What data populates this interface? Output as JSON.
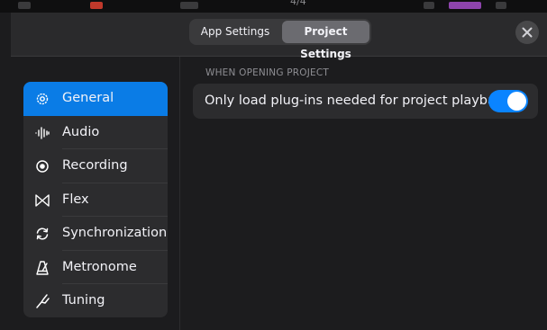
{
  "top_strip": {
    "time_signature": "4/4"
  },
  "tabs": [
    {
      "label": "App Settings",
      "selected": false
    },
    {
      "label": "Project Settings",
      "selected": true
    }
  ],
  "close_icon": "xmark-icon",
  "sidebar": {
    "items": [
      {
        "label": "General",
        "icon": "gear-icon",
        "active": true
      },
      {
        "label": "Audio",
        "icon": "waveform-icon",
        "active": false
      },
      {
        "label": "Recording",
        "icon": "record-icon",
        "active": false
      },
      {
        "label": "Flex",
        "icon": "flex-icon",
        "active": false
      },
      {
        "label": "Synchronization",
        "icon": "sync-icon",
        "active": false
      },
      {
        "label": "Metronome",
        "icon": "metronome-icon",
        "active": false
      },
      {
        "label": "Tuning",
        "icon": "tuning-fork-icon",
        "active": false
      }
    ]
  },
  "main": {
    "section_header": "WHEN OPENING PROJECT",
    "rows": [
      {
        "label": "Only load plug-ins needed for project playback",
        "toggle_on": true
      }
    ]
  },
  "colors": {
    "accent": "#0a84ff",
    "sidebar_active": "#0a7ce6",
    "background": "#1c1c1e"
  }
}
